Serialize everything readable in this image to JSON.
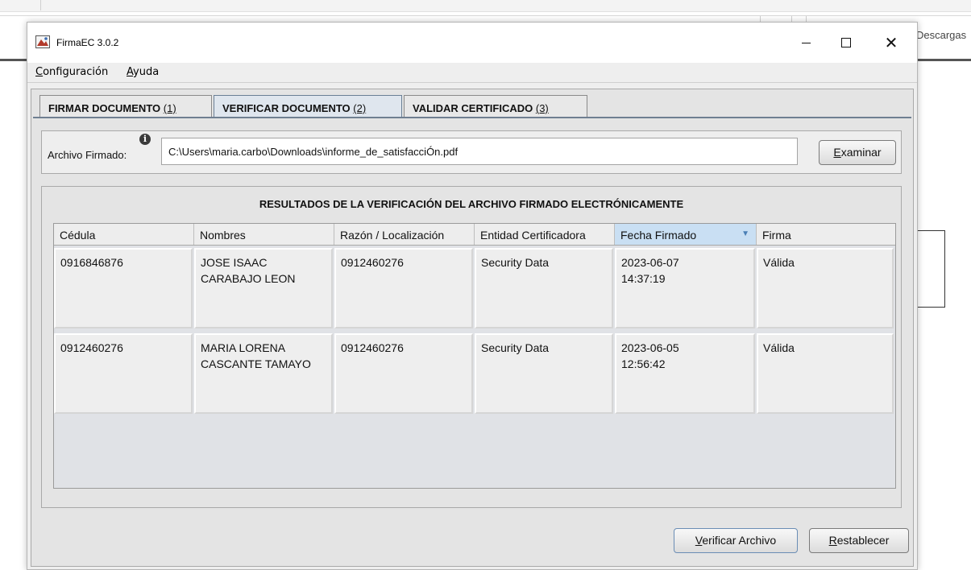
{
  "background": {
    "descargas_label": "Descargas"
  },
  "window": {
    "title": "FirmaEC 3.0.2",
    "minimize": "—",
    "close": "✕"
  },
  "menu": {
    "items": [
      {
        "mnemonic": "C",
        "rest": "onfiguración"
      },
      {
        "mnemonic": "A",
        "rest": "yuda"
      }
    ]
  },
  "tabs": [
    {
      "label": "FIRMAR DOCUMENTO ",
      "shortcut": "(1)"
    },
    {
      "label": "VERIFICAR DOCUMENTO ",
      "shortcut": "(2)",
      "selected": true
    },
    {
      "label": "VALIDAR CERTIFICADO ",
      "shortcut": "(3)"
    }
  ],
  "archivo": {
    "label": "Archivo Firmado:",
    "info_icon": "info-icon",
    "value": "C:\\Users\\maria.carbo\\Downloads\\informe_de_satisfacciÓn.pdf",
    "examinar_mnemonic": "E",
    "examinar_rest": "xaminar"
  },
  "results": {
    "title": "RESULTADOS DE LA VERIFICACIÓN DEL ARCHIVO FIRMADO ELECTRÓNICAMENTE",
    "columns": [
      "Cédula",
      "Nombres",
      "Razón / Localización",
      "Entidad Certificadora",
      "Fecha Firmado",
      "Firma"
    ],
    "sort_indicator": "▼",
    "rows": [
      {
        "cedula": "0916846876",
        "nombres": [
          "JOSE ISAAC",
          "CARABAJO LEON"
        ],
        "razon": "0912460276",
        "entidad": "Security Data",
        "fecha": [
          "2023-06-07",
          "14:37:19"
        ],
        "firma": "Válida"
      },
      {
        "cedula": "0912460276",
        "nombres": [
          "MARIA LORENA",
          "CASCANTE TAMAYO"
        ],
        "razon": "0912460276",
        "entidad": "Security Data",
        "fecha": [
          "2023-06-05",
          "12:56:42"
        ],
        "firma": "Válida"
      }
    ]
  },
  "buttons": {
    "verificar_mnemonic": "V",
    "verificar_rest": "erificar Archivo",
    "restablecer_mnemonic": "R",
    "restablecer_rest": "establecer"
  }
}
